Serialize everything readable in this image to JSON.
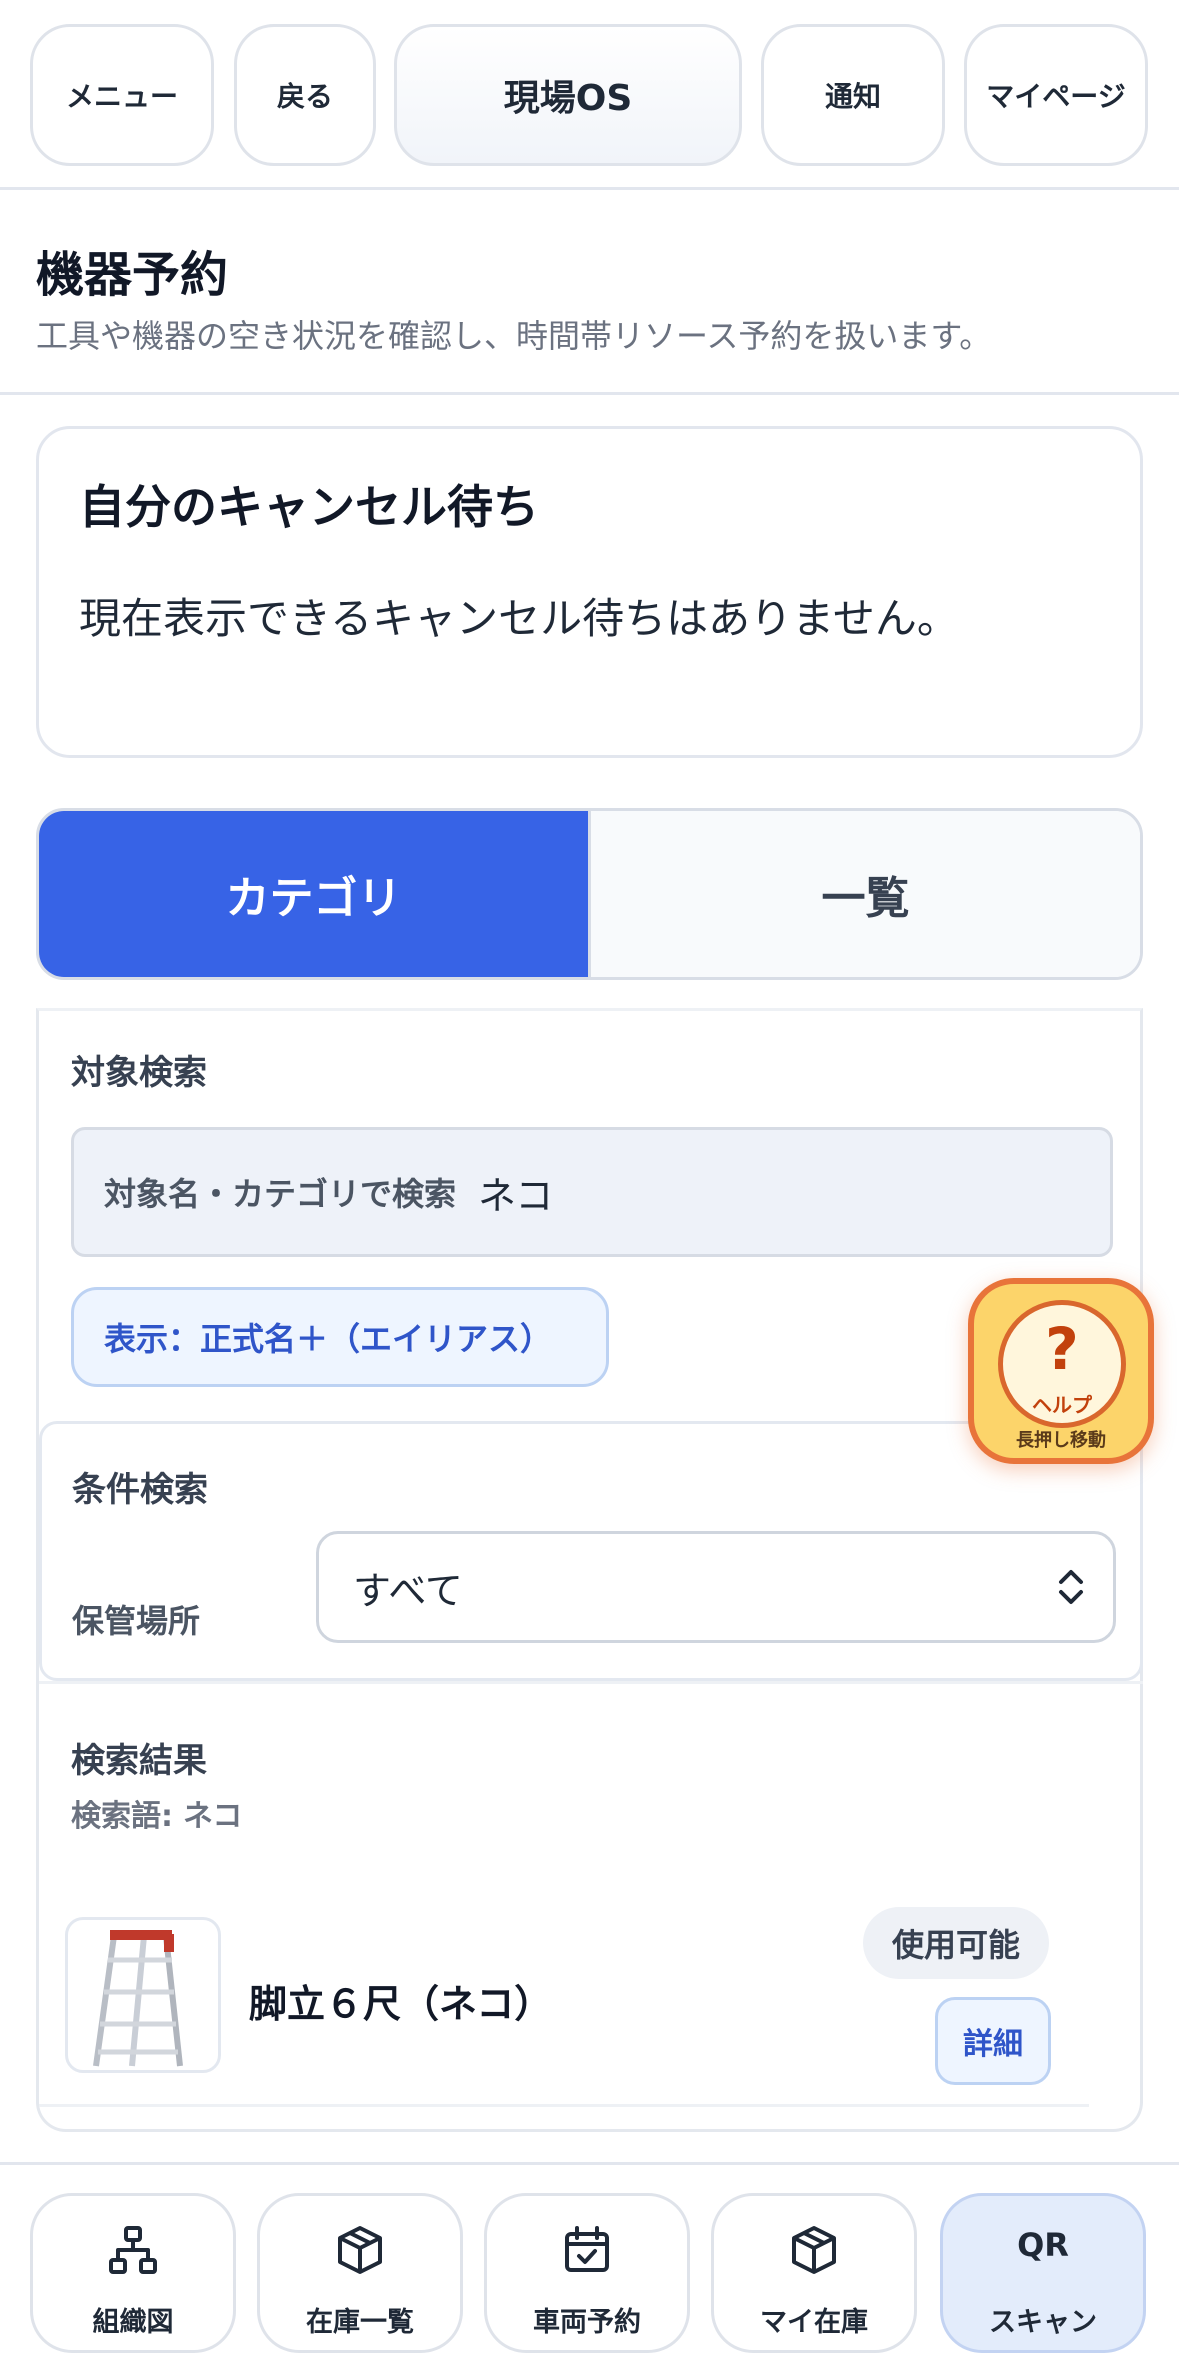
{
  "topnav": {
    "menu": "メニュー",
    "back": "戻る",
    "brand": "現場OS",
    "notify": "通知",
    "mypage": "マイページ"
  },
  "page": {
    "title": "機器予約",
    "subtitle": "工具や機器の空き状況を確認し、時間帯リソース予約を扱います。"
  },
  "waitlist": {
    "title": "自分のキャンセル待ち",
    "message": "現在表示できるキャンセル待ちはありません。"
  },
  "tabs": [
    {
      "label": "カテゴリ",
      "active": true
    },
    {
      "label": "一覧",
      "active": false
    }
  ],
  "search": {
    "section_label": "対象検索",
    "field_label": "対象名・カテゴリで検索",
    "value": "ネコ",
    "display_mode": "表示：正式名＋（エイリアス）"
  },
  "conditions": {
    "section_label": "条件検索",
    "storage_label": "保管場所",
    "storage_value": "すべて"
  },
  "results": {
    "label": "検索結果",
    "term_label": "検索語:",
    "term_value": "ネコ",
    "items": [
      {
        "name": "脚立６尺（ネコ）",
        "status": "使用可能",
        "detail": "詳細",
        "icon": "ladder-image"
      }
    ]
  },
  "help": {
    "symbol": "?",
    "label": "ヘルプ",
    "hint": "長押し移動"
  },
  "bottomnav": {
    "items": [
      {
        "label": "組織図",
        "icon": "org-chart-icon"
      },
      {
        "label": "在庫一覧",
        "icon": "box-icon"
      },
      {
        "label": "車両予約",
        "icon": "calendar-check-icon"
      },
      {
        "label": "マイ在庫",
        "icon": "box-icon"
      },
      {
        "label": "スキャン",
        "qr_text": "QR"
      }
    ]
  },
  "colors": {
    "accent": "#3763e6",
    "help": "#fcd46a",
    "help_border": "#e8743a"
  }
}
